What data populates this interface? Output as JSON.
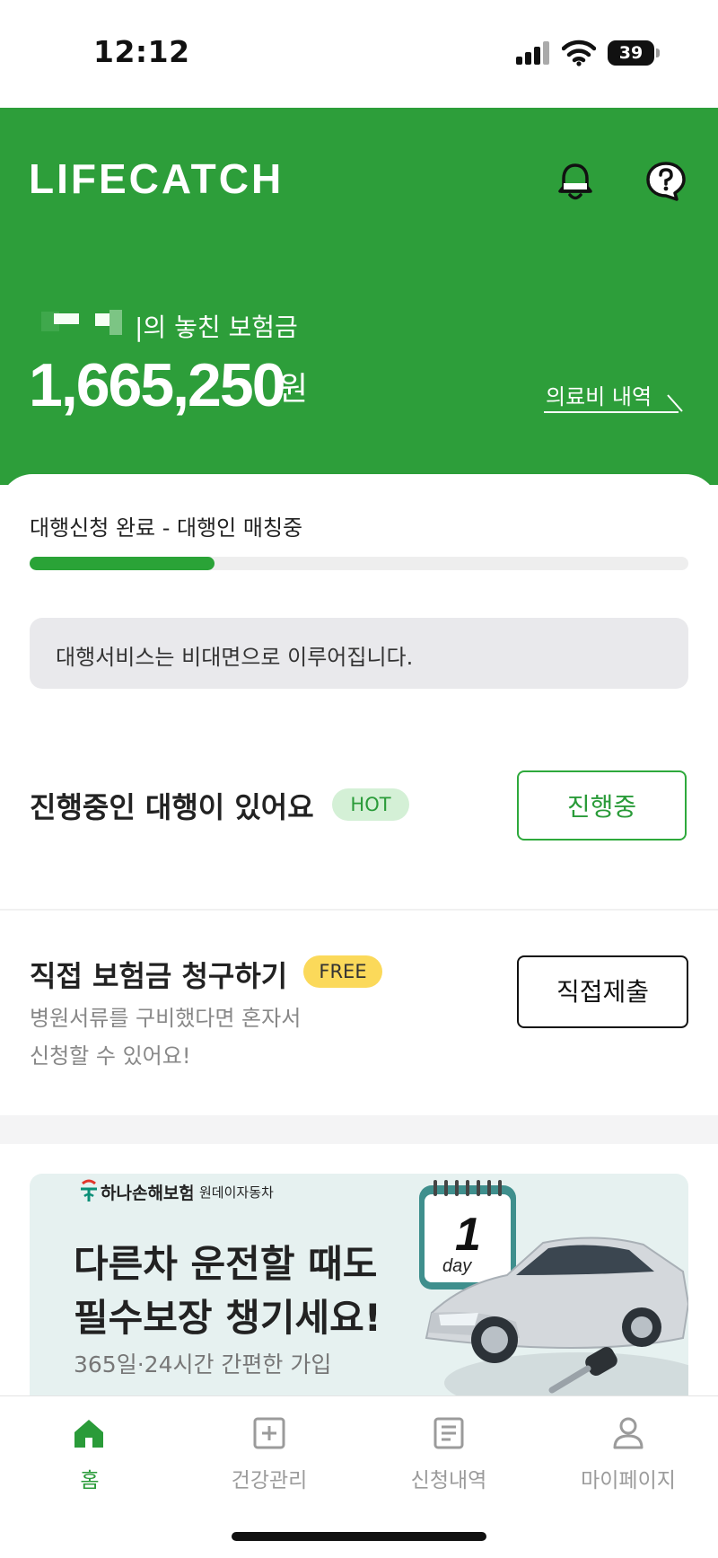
{
  "status_bar": {
    "time": "12:12",
    "battery": "39"
  },
  "header": {
    "logo": "LIFECATCH",
    "notification_icon": "bell-icon",
    "help_icon": "help-chat-icon"
  },
  "summary": {
    "missed_label": "|의 놓친 보험금",
    "amount": "1,665,250",
    "currency": "원",
    "medical_link": "의료비 내역"
  },
  "progress": {
    "label": "대행신청 완료 - 대행인 매칭중",
    "fraction": 0.28,
    "accent": "#2aa337"
  },
  "notice": "대행서비스는 비대면으로 이루어집니다.",
  "ongoing": {
    "title": "진행중인 대행이 있어요",
    "badge": "HOT",
    "button": "진행중"
  },
  "direct": {
    "title": "직접 보험금 청구하기",
    "badge": "FREE",
    "sub_line1": "병원서류를 구비했다면 혼자서",
    "sub_line2": "신청할 수 있어요!",
    "button": "직접제출"
  },
  "banner": {
    "brand": "하나손해보험",
    "product": "원데이자동차",
    "line1": "다른차 운전할 때도",
    "line2": "필수보장 챙기세요!",
    "sub": "365일·24시간 간편한 가입",
    "calendar_number": "1",
    "calendar_unit": "day"
  },
  "tabs": [
    {
      "label": "홈",
      "icon": "home-icon",
      "active": true
    },
    {
      "label": "건강관리",
      "icon": "plus-box-icon",
      "active": false
    },
    {
      "label": "신청내역",
      "icon": "document-icon",
      "active": false
    },
    {
      "label": "마이페이지",
      "icon": "user-icon",
      "active": false
    }
  ],
  "colors": {
    "brand_green": "#2d9e3a",
    "active_tab": "#2a9b39",
    "inactive_tab": "#9b9b9b"
  }
}
